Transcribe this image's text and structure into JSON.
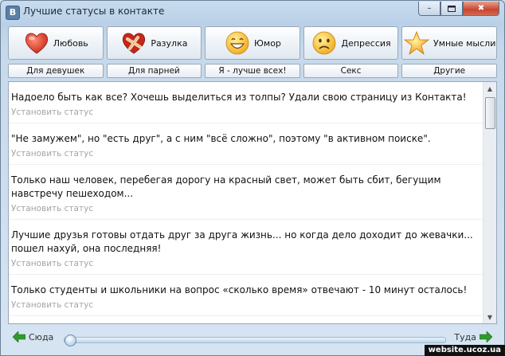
{
  "window": {
    "title": "Лучшие статусы в контакте",
    "app_icon": "В",
    "min": "–",
    "close": "✖"
  },
  "categories": [
    {
      "label": "Любовь",
      "icon": "heart-icon"
    },
    {
      "label": "Разулка",
      "icon": "broken-heart-icon"
    },
    {
      "label": "Юмор",
      "icon": "laughing-smiley-icon"
    },
    {
      "label": "Депрессия",
      "icon": "sad-smiley-icon"
    },
    {
      "label": "Умные мысли",
      "icon": "star-icon"
    }
  ],
  "subcategories": [
    "Для девушек",
    "Для парней",
    "Я - лучше всех!",
    "Секс",
    "Другие"
  ],
  "statuses": [
    {
      "text": "Надоело быть как все? Хочешь выделиться из толпы? Удали свою страницу из Контакта!",
      "action": "Установить статус"
    },
    {
      "text": "\"Не замужем\", но \"есть друг\", а с ним \"всё сложно\", поэтому \"в активном поиске\".",
      "action": "Установить статус"
    },
    {
      "text": "Только наш человек, перебегая дорогу на красный свет, может быть сбит, бегущим навстречу пешеходом...",
      "action": "Установить статус"
    },
    {
      "text": "Лучшие друзья готовы отдать друг за друга жизнь... но когда дело доходит до жевачки... пошел нахуй, она последняя!",
      "action": "Установить статус"
    },
    {
      "text": "Только студенты и школьники на вопрос «сколько время» отвечают - 10 минут осталось!",
      "action": "Установить статус"
    }
  ],
  "footer": {
    "prev_label": "Сюда",
    "next_label": "Туда",
    "position": 0.0
  },
  "watermark": "website.ucoz.ua",
  "colors": {
    "accent": "#2e9a2e",
    "title_bar": "#c9dcee",
    "muted_text": "#a4a4a4"
  }
}
